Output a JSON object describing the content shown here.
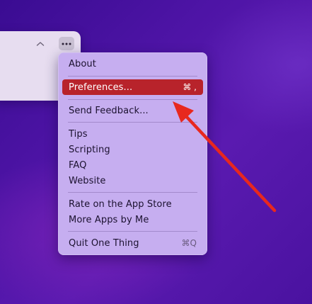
{
  "window": {
    "collapse_icon": "chevron-up-icon",
    "more_icon": "ellipsis-icon"
  },
  "menu": {
    "items": [
      {
        "label": "About",
        "shortcut": ""
      },
      {
        "label": "Preferences...",
        "shortcut": "⌘ ,",
        "highlighted": true
      },
      {
        "label": "Send Feedback...",
        "shortcut": ""
      },
      {
        "label": "Tips",
        "shortcut": ""
      },
      {
        "label": "Scripting",
        "shortcut": ""
      },
      {
        "label": "FAQ",
        "shortcut": ""
      },
      {
        "label": "Website",
        "shortcut": ""
      },
      {
        "label": "Rate on the App Store",
        "shortcut": ""
      },
      {
        "label": "More Apps by Me",
        "shortcut": ""
      },
      {
        "label": "Quit One Thing",
        "shortcut": "⌘Q"
      }
    ]
  },
  "annotation": {
    "arrow_color": "#e8281e",
    "highlight_color": "#b8232b"
  }
}
